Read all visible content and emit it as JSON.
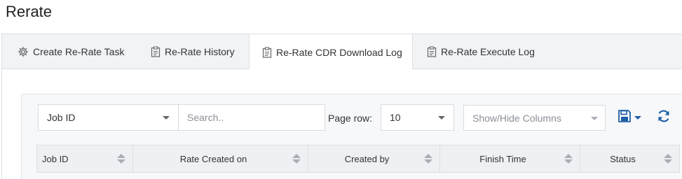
{
  "page": {
    "title": "Rerate"
  },
  "tabs": [
    {
      "label": "Create Re-Rate Task",
      "icon": "gear-icon"
    },
    {
      "label": "Re-Rate History",
      "icon": "clipboard-icon"
    },
    {
      "label": "Re-Rate CDR Download Log",
      "icon": "clipboard-icon",
      "active": true
    },
    {
      "label": "Re-Rate Execute Log",
      "icon": "clipboard-icon"
    }
  ],
  "filters": {
    "field_select": "Job ID",
    "search_placeholder": "Search..",
    "page_row_label": "Page row:",
    "page_row_value": "10",
    "columns_placeholder": "Show/Hide Columns"
  },
  "table": {
    "columns": [
      "Job ID",
      "Rate Created on",
      "Created by",
      "Finish Time",
      "Status"
    ]
  },
  "colors": {
    "accent": "#1f5fa6"
  }
}
